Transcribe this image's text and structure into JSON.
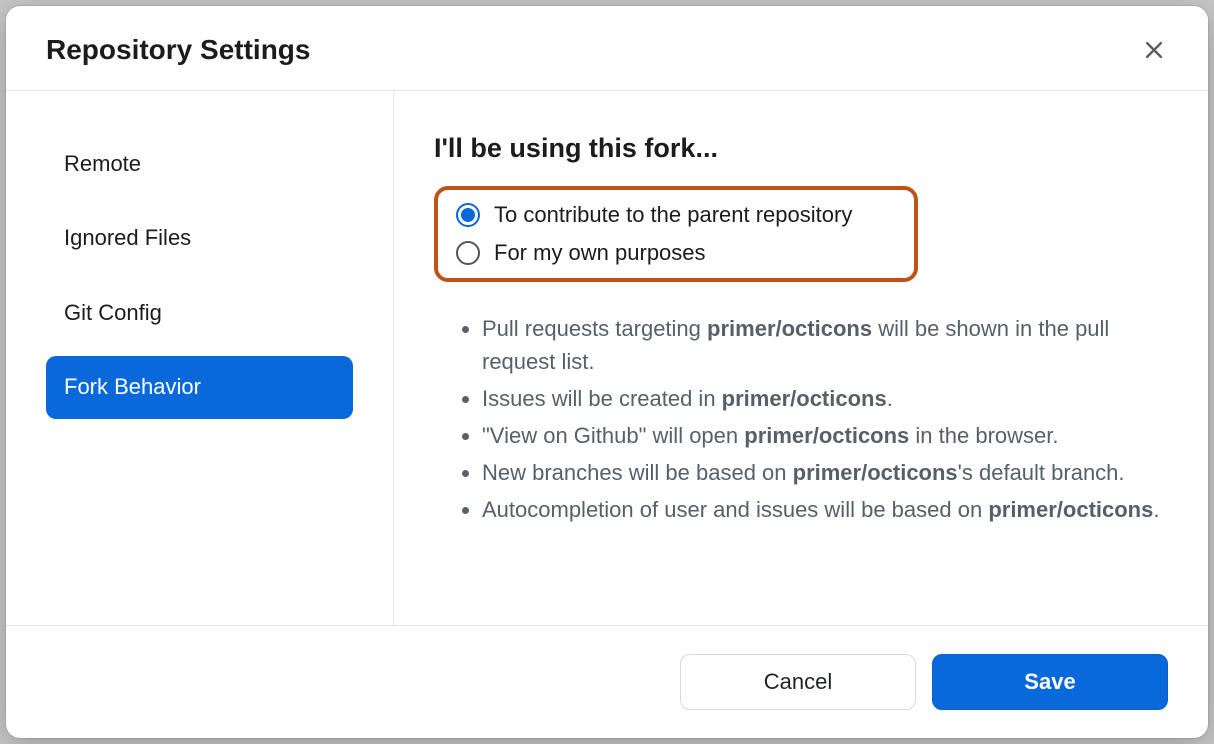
{
  "header": {
    "title": "Repository Settings"
  },
  "sidebar": {
    "items": [
      {
        "label": "Remote",
        "active": false
      },
      {
        "label": "Ignored Files",
        "active": false
      },
      {
        "label": "Git Config",
        "active": false
      },
      {
        "label": "Fork Behavior",
        "active": true
      }
    ]
  },
  "content": {
    "heading": "I'll be using this fork...",
    "options": [
      {
        "label": "To contribute to the parent repository",
        "selected": true
      },
      {
        "label": "For my own purposes",
        "selected": false
      }
    ],
    "repo": "primer/octicons",
    "bullets": [
      {
        "pre": "Pull requests targeting ",
        "strong": "primer/octicons",
        "post": " will be shown in the pull request list."
      },
      {
        "pre": "Issues will be created in ",
        "strong": "primer/octicons",
        "post": "."
      },
      {
        "pre": "\"View on Github\" will open ",
        "strong": "primer/octicons",
        "post": " in the browser."
      },
      {
        "pre": "New branches will be based on ",
        "strong": "primer/octicons",
        "post": "'s default branch."
      },
      {
        "pre": "Autocompletion of user and issues will be based on ",
        "strong": "primer/octicons",
        "post": "."
      }
    ]
  },
  "footer": {
    "cancel": "Cancel",
    "save": "Save"
  },
  "colors": {
    "accent": "#0969da",
    "highlightBorder": "#bd5316"
  }
}
